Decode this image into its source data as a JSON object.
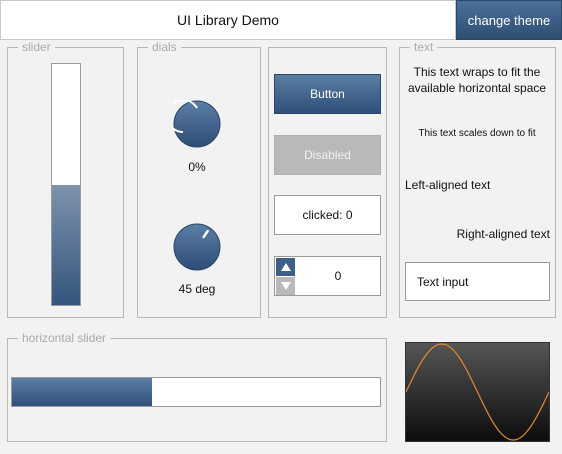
{
  "header": {
    "title": "UI Library Demo",
    "theme_button_label": "change theme"
  },
  "groups": {
    "slider": "slider",
    "dials": "dials",
    "text": "text",
    "horizontal_slider": "horizontal slider"
  },
  "slider": {
    "value_fraction": 0.5
  },
  "dials": [
    {
      "label": "0%",
      "value_fraction": 0.0
    },
    {
      "label": "45 deg",
      "value_fraction": 0.625
    }
  ],
  "buttons": {
    "button_label": "Button",
    "disabled_label": "Disabled",
    "clicked_label": "clicked: 0"
  },
  "spinbox": {
    "value": "0"
  },
  "text_panel": {
    "wrap_text": "This text wraps to fit the available horizontal space",
    "scaled_text": "This text scales down to fit",
    "left_text": "Left-aligned text",
    "right_text": "Right-aligned text",
    "input_value": "Text input"
  },
  "horizontal_slider": {
    "value_fraction": 0.38
  },
  "plot": {
    "curve": "sine",
    "color": "#e08a2e"
  },
  "colors": {
    "accent": "#34557d",
    "accent_light": "#5b7ea5",
    "disabled": "#b9b9b9",
    "background": "#f2f2f2"
  }
}
